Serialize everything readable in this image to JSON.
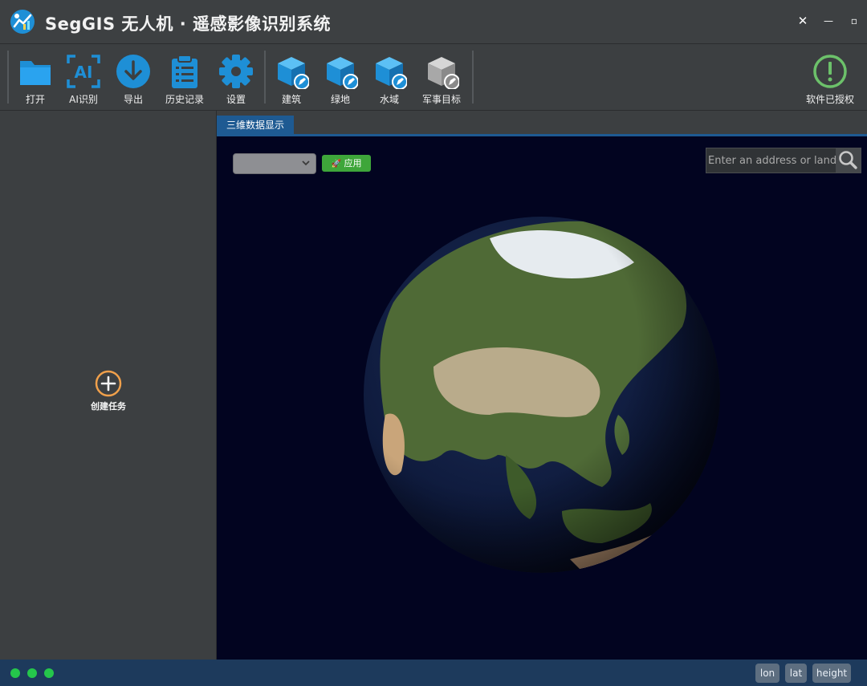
{
  "window": {
    "title": "SegGIS 无人机 · 遥感影像识别系统",
    "close_glyph": "✕",
    "minimize_glyph": "—",
    "maximize_glyph": "▫"
  },
  "toolbar": {
    "open_label": "打开",
    "ai_label": "AI识别",
    "export_label": "导出",
    "history_label": "历史记录",
    "settings_label": "设置",
    "building_label": "建筑",
    "green_label": "绿地",
    "water_label": "水域",
    "military_label": "军事目标",
    "license_label": "软件已授权"
  },
  "sidebar": {
    "create_task_label": "创建任务"
  },
  "tabs": [
    {
      "label": "三维数据显示",
      "active": true
    }
  ],
  "viewer": {
    "layer_select_value": "",
    "apply_label": "应用",
    "search_placeholder": "Enter an address or landn",
    "search_value": ""
  },
  "status": {
    "lon_label": "lon",
    "lat_label": "lat",
    "height_label": "height"
  },
  "colors": {
    "accent_blue": "#1e8fd6",
    "tab_blue": "#1e5a92",
    "status_green": "#25c64b",
    "apply_green": "#3ea63a",
    "license_green": "#6cc16a"
  },
  "icons": {
    "logo": "app-logo-icon",
    "open": "folder-icon",
    "ai": "ai-scan-icon",
    "export": "download-icon",
    "history": "clipboard-icon",
    "settings": "gear-icon",
    "building": "cube-edit-icon",
    "license": "exclamation-circle-icon",
    "search": "search-icon"
  }
}
